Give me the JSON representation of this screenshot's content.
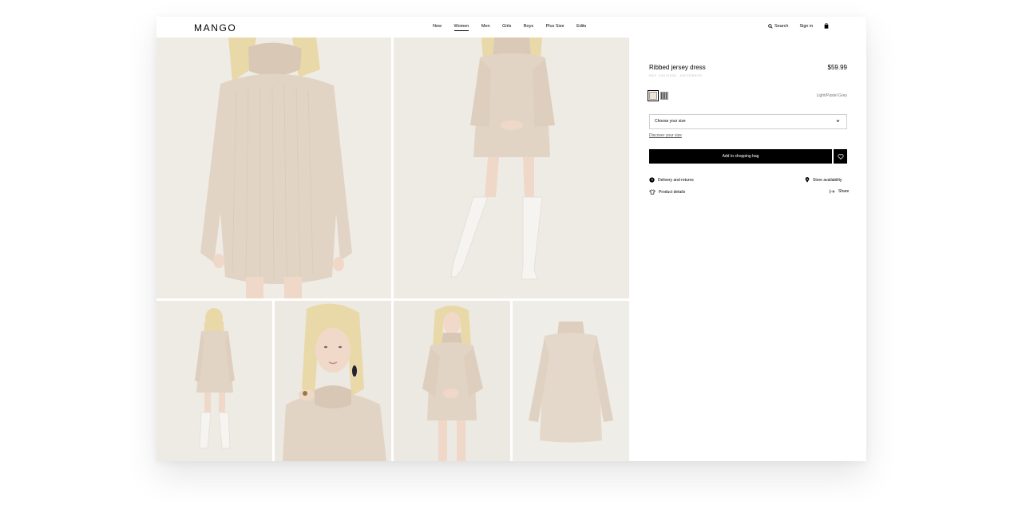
{
  "brand": {
    "logo_text": "MANGO"
  },
  "nav": {
    "items": [
      {
        "label": "New",
        "active": false
      },
      {
        "label": "Women",
        "active": true
      },
      {
        "label": "Men",
        "active": false
      },
      {
        "label": "Girls",
        "active": false
      },
      {
        "label": "Boys",
        "active": false
      },
      {
        "label": "Plus Size",
        "active": false
      },
      {
        "label": "Edits",
        "active": false
      }
    ]
  },
  "header_actions": {
    "search_label": "Search",
    "signin_label": "Sign in",
    "bag_icon": "shopping-bag-icon",
    "search_icon": "search-icon"
  },
  "gallery": {
    "photos": [
      {
        "name": "photo-front-closeup",
        "alt": "model front close-up"
      },
      {
        "name": "photo-front-full",
        "alt": "model front full length"
      },
      {
        "name": "photo-back",
        "alt": "model back view"
      },
      {
        "name": "photo-portrait",
        "alt": "model portrait"
      },
      {
        "name": "photo-standing",
        "alt": "model standing"
      },
      {
        "name": "photo-flat",
        "alt": "dress flat lay"
      }
    ]
  },
  "product": {
    "title": "Ribbed jersey dress",
    "price": "$59.99",
    "ref": "REF. 53070538 - KNITDRESS",
    "color_name": "Light/Pastel Grey",
    "swatches": [
      {
        "color": "#ede3d6",
        "selected": true
      },
      {
        "color": "#6b6b6b",
        "selected": false
      }
    ],
    "size_placeholder": "Choose your size",
    "discover_size": "Discover your size",
    "add_to_bag": "Add to shopping bag",
    "links": {
      "delivery": "Delivery and returns",
      "store": "Store availability",
      "details": "Product details",
      "share": "Share"
    }
  },
  "colors": {
    "accent": "#000000",
    "dress": "#e6d9cb",
    "background_photo": "#efece6"
  }
}
